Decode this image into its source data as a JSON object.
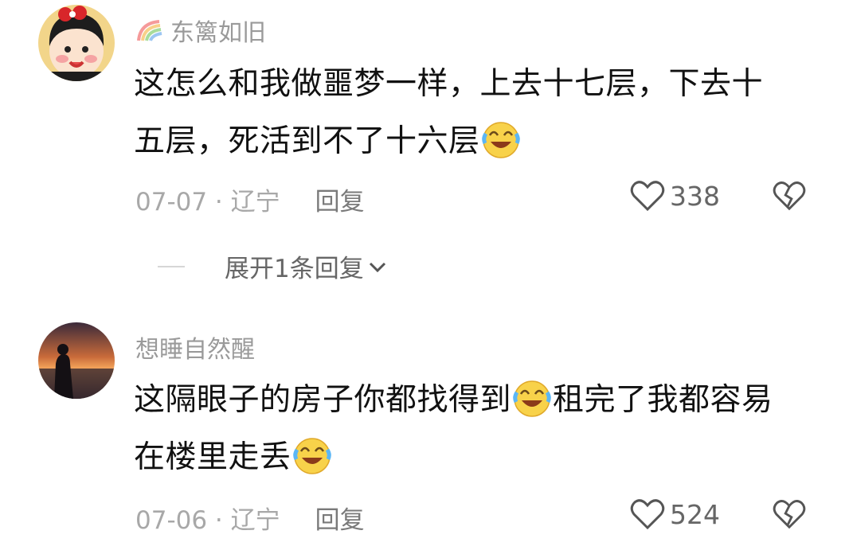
{
  "comments": [
    {
      "username": "东篱如旧",
      "text_line1": "这怎么和我做噩梦一样，上去十七层，下去十",
      "text_line2": "五层，死活到不了十六层",
      "date_location": "07-07 · 辽宁",
      "reply_label": "回复",
      "likes": "338",
      "expand_replies_label": "展开1条回复"
    },
    {
      "username": "想睡自然醒",
      "text_line1_a": "这隔眼子的房子你都找得到",
      "text_line1_b": "租完了我都容易",
      "text_line2": "在楼里走丢",
      "date_location": "07-06 · 辽宁",
      "reply_label": "回复",
      "likes": "524"
    }
  ],
  "icons": {
    "like": "heart-outline-icon",
    "dislike": "broken-heart-icon",
    "expand": "chevron-down-icon",
    "emoji": "laugh-cry-emoji",
    "badge": "rainbow-icon"
  },
  "colors": {
    "username": "#9a9a9a",
    "meta": "#a8a8a8",
    "reply": "#7a7a7a",
    "text": "#111111"
  }
}
